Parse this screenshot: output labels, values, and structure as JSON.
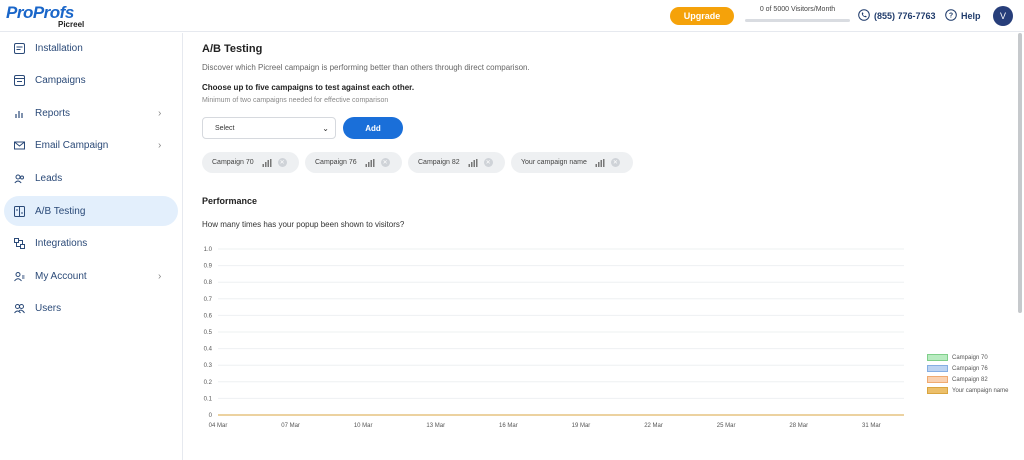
{
  "header": {
    "logo_brand": "ProProfs",
    "logo_sub": "Picreel",
    "upgrade_label": "Upgrade",
    "visitors_text": "0 of 5000 Visitors/Month",
    "visitors_progress": 0,
    "phone": "(855) 776-7763",
    "help_label": "Help",
    "avatar_initial": "V"
  },
  "sidebar": {
    "items": [
      {
        "label": "Installation",
        "icon": "installation-icon",
        "chevron": false,
        "active": false
      },
      {
        "label": "Campaigns",
        "icon": "campaigns-icon",
        "chevron": false,
        "active": false
      },
      {
        "label": "Reports",
        "icon": "reports-icon",
        "chevron": true,
        "active": false
      },
      {
        "label": "Email Campaign",
        "icon": "email-icon",
        "chevron": true,
        "active": false
      },
      {
        "label": "Leads",
        "icon": "leads-icon",
        "chevron": false,
        "active": false
      },
      {
        "label": "A/B Testing",
        "icon": "ab-testing-icon",
        "chevron": false,
        "active": true
      },
      {
        "label": "Integrations",
        "icon": "integrations-icon",
        "chevron": false,
        "active": false
      },
      {
        "label": "My Account",
        "icon": "account-icon",
        "chevron": true,
        "active": false
      },
      {
        "label": "Users",
        "icon": "users-icon",
        "chevron": false,
        "active": false
      }
    ]
  },
  "main": {
    "title": "A/B Testing",
    "description": "Discover which Picreel campaign is performing better than others through direct comparison.",
    "choose_title": "Choose up to five campaigns to test against each other.",
    "choose_hint": "Minimum of two campaigns needed for effective comparison",
    "select_value": "Select",
    "add_label": "Add",
    "chips": [
      {
        "label": "Campaign 70"
      },
      {
        "label": "Campaign 76"
      },
      {
        "label": "Campaign 82"
      },
      {
        "label": "Your campaign name"
      }
    ],
    "performance_title": "Performance",
    "performance_question": "How many times has your popup been shown to visitors?"
  },
  "chart_data": {
    "type": "area",
    "title": "",
    "xlabel": "",
    "ylabel": "",
    "x": [
      "04 Mar",
      "07 Mar",
      "10 Mar",
      "13 Mar",
      "16 Mar",
      "19 Mar",
      "22 Mar",
      "25 Mar",
      "28 Mar",
      "31 Mar"
    ],
    "yticks": [
      "1.0",
      "0.9",
      "0.8",
      "0.7",
      "0.6",
      "0.5",
      "0.4",
      "0.3",
      "0.2",
      "0.1",
      "0"
    ],
    "ylim": [
      0,
      1
    ],
    "grid": true,
    "legend_position": "right",
    "series": [
      {
        "name": "Campaign 70",
        "color": "#b8ebc0",
        "border": "#7fcf8a",
        "values": [
          0,
          0,
          0,
          0,
          0,
          0,
          0,
          0,
          0,
          0
        ]
      },
      {
        "name": "Campaign 76",
        "color": "#bcd3f2",
        "border": "#85aee3",
        "values": [
          0,
          0,
          0,
          0,
          0,
          0,
          0,
          0,
          0,
          0
        ]
      },
      {
        "name": "Campaign 82",
        "color": "#f9d1b0",
        "border": "#f0aa70",
        "values": [
          0,
          0,
          0,
          0,
          0,
          0,
          0,
          0,
          0,
          0
        ]
      },
      {
        "name": "Your campaign name",
        "color": "#ecbf6a",
        "border": "#d9a540",
        "values": [
          0,
          0,
          0,
          0,
          0,
          0,
          0,
          0,
          0,
          0
        ]
      }
    ]
  }
}
